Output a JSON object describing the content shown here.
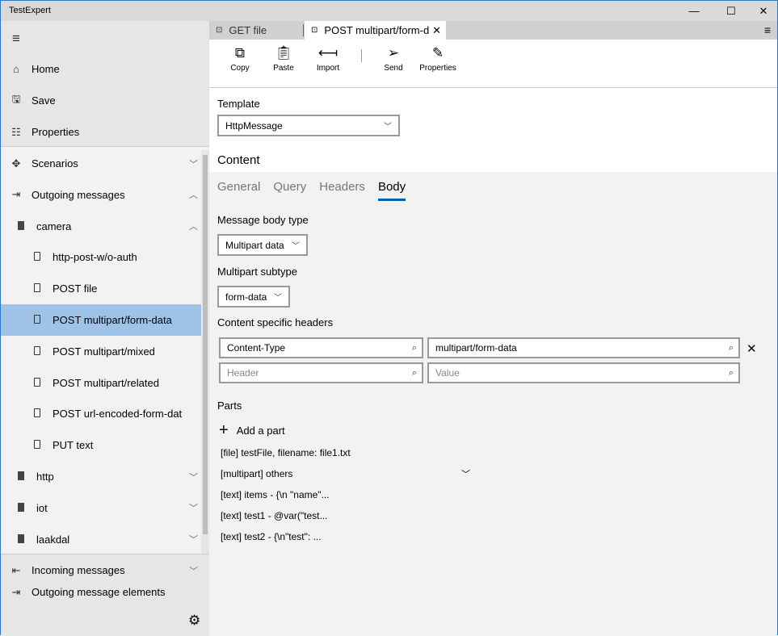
{
  "window": {
    "title": "TestExpert",
    "minimize": "—",
    "maximize": "☐",
    "close": "✕"
  },
  "sidebar": {
    "top": [
      {
        "icon": "home-icon",
        "glyph": "⌂",
        "label": "Home"
      },
      {
        "icon": "save-icon",
        "glyph": "🖫",
        "label": "Save"
      },
      {
        "icon": "properties-icon",
        "glyph": "☷",
        "label": "Properties"
      }
    ],
    "items": [
      {
        "label": "Scenarios",
        "level": 0,
        "icon": "scenarios-icon",
        "glyph": "✥",
        "chevron": "﹀"
      },
      {
        "label": "Outgoing messages",
        "level": 0,
        "icon": "outgoing-icon",
        "glyph": "⇥",
        "chevron": "︿"
      },
      {
        "label": "camera",
        "level": 1,
        "icon": "folder-icon",
        "chevron": "︿"
      },
      {
        "label": "http-post-w/o-auth",
        "level": 2,
        "icon": "document-icon"
      },
      {
        "label": "POST file",
        "level": 2,
        "icon": "document-icon"
      },
      {
        "label": "POST multipart/form-data",
        "level": 2,
        "icon": "document-icon",
        "selected": true
      },
      {
        "label": "POST multipart/mixed",
        "level": 2,
        "icon": "document-icon"
      },
      {
        "label": "POST multipart/related",
        "level": 2,
        "icon": "document-icon"
      },
      {
        "label": "POST url-encoded-form-dat",
        "level": 2,
        "icon": "document-icon"
      },
      {
        "label": "PUT text",
        "level": 2,
        "icon": "document-icon"
      },
      {
        "label": "http",
        "level": 1,
        "icon": "folder-icon",
        "chevron": "﹀"
      },
      {
        "label": "iot",
        "level": 1,
        "icon": "folder-icon",
        "chevron": "﹀"
      },
      {
        "label": "laakdal",
        "level": 1,
        "icon": "folder-icon",
        "chevron": "﹀"
      }
    ],
    "footer": [
      {
        "label": "Incoming messages",
        "icon": "incoming-icon",
        "glyph": "⇤",
        "chevron": "﹀"
      },
      {
        "label": "Outgoing message elements",
        "icon": "outgoing-elements-icon",
        "glyph": "⇥"
      }
    ],
    "selected_color": "#9ec3e6"
  },
  "tabs": [
    {
      "label": "GET file",
      "active": false
    },
    {
      "label": "POST multipart/form-d",
      "active": true
    }
  ],
  "toolbar": {
    "copy": "Copy",
    "paste": "Paste",
    "import": "Import",
    "send": "Send",
    "properties": "Properties"
  },
  "template": {
    "label": "Template",
    "value": "HttpMessage"
  },
  "content": {
    "title": "Content",
    "tabs": [
      "General",
      "Query",
      "Headers",
      "Body"
    ],
    "active_tab": "Body"
  },
  "body": {
    "body_type_label": "Message body type",
    "body_type_value": "Multipart data",
    "subtype_label": "Multipart subtype",
    "subtype_value": "form-data",
    "headers_label": "Content specific headers",
    "headers": [
      {
        "name": "Content-Type",
        "value": "multipart/form-data"
      }
    ],
    "new_header_placeholder": "Header",
    "new_value_placeholder": "Value",
    "parts_label": "Parts",
    "add_part": "Add a part",
    "parts": [
      "[file] testFile, filename: file1.txt",
      "[multipart] others",
      "[text] items - {\\n  \"name\"...",
      "[text] test1 - @var(\"test...",
      "[text] test2 - {\\n\"test\": ..."
    ]
  },
  "accent": "#0063b1"
}
